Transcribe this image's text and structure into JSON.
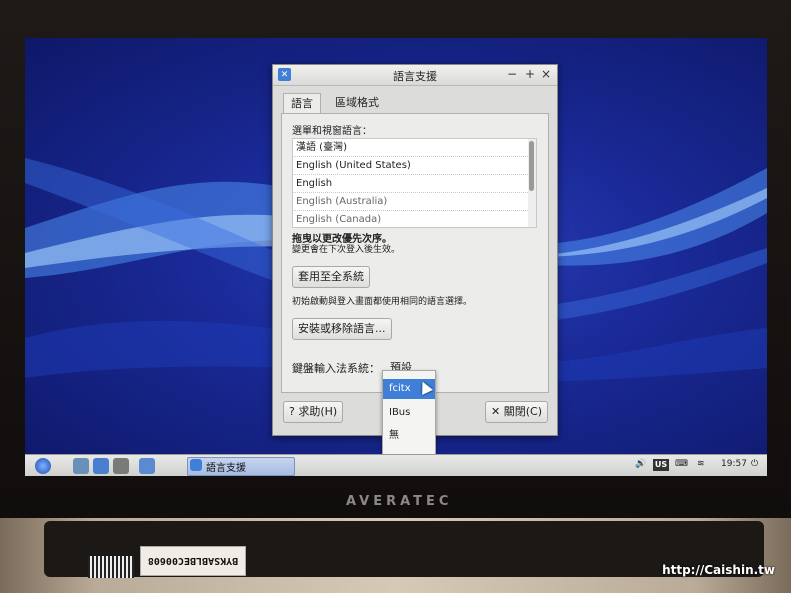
{
  "window": {
    "title": "語言支援",
    "minimize": "−",
    "maximize": "+",
    "close": "×"
  },
  "tabs": [
    {
      "label": "語言"
    },
    {
      "label": "區域格式"
    }
  ],
  "language_section": {
    "heading": "選單和視窗語言：",
    "items": [
      {
        "label": "漢語 (臺灣)"
      },
      {
        "label": "English (United States)"
      },
      {
        "label": "English"
      },
      {
        "label": "English (Australia)"
      },
      {
        "label": "English (Canada)"
      }
    ],
    "drag_hint": "拖曳以更改優先次序。",
    "note": "變更會在下次登入後生效。"
  },
  "apply_system_button": "套用至全系統",
  "apply_note": "初始啟動與登入畫面都使用相同的語言選擇。",
  "install_remove_button": "安裝或移除語言...",
  "keyboard_input": {
    "label": "鍵盤輸入法系統：",
    "current": "預設",
    "options": [
      "fcitx",
      "IBus",
      "無"
    ],
    "highlighted": "fcitx"
  },
  "help_button": "求助(H)",
  "close_button": "關閉(C)",
  "taskbar": {
    "task_label": "語言支援",
    "keyboard_layout": "US",
    "clock": "19:57"
  },
  "hardware": {
    "brand": "AVERATEC",
    "sticker": "BYKSABLBEC00608",
    "watermark": "http://Caishin.tw"
  }
}
